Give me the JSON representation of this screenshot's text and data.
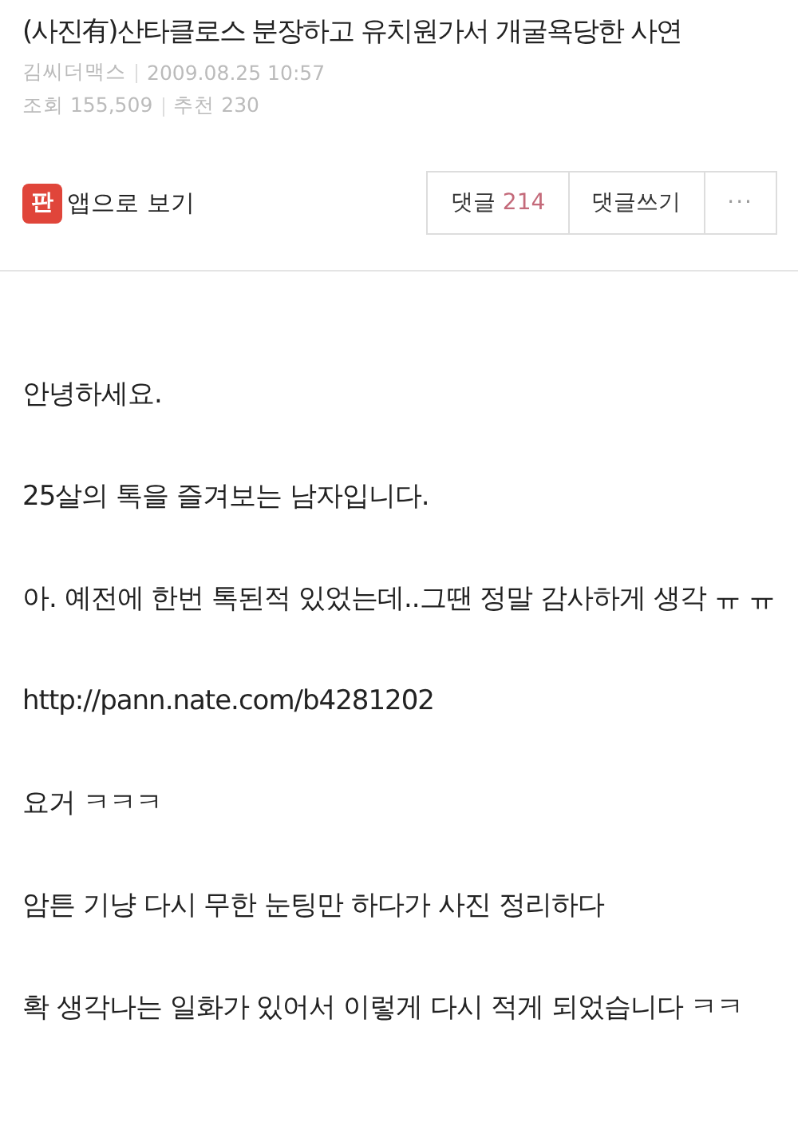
{
  "title": "(사진有)산타클로스 분장하고 유치원가서 개굴욕당한 사연",
  "author": "김씨더맥스",
  "date": "2009.08.25 10:57",
  "views_label": "조회",
  "views": "155,509",
  "recommend_label": "추천",
  "recommend": "230",
  "app_link": {
    "icon": "판",
    "label": "앱으로 보기"
  },
  "comments_button": {
    "label": "댓글",
    "count": "214"
  },
  "write_comment_button": "댓글쓰기",
  "more_button": "···",
  "paragraphs": [
    "안녕하세요.",
    "25살의 톡을 즐겨보는 남자입니다.",
    "아. 예전에 한번 톡된적 있었는데..그땐 정말 감사하게 생각 ㅠ ㅠ",
    "http://pann.nate.com/b4281202",
    "요거 ㅋㅋㅋ",
    "암튼 기냥 다시 무한 눈팅만 하다가 사진 정리하다",
    "확 생각나는 일화가 있어서 이렇게 다시 적게 되었습니다 ㅋㅋ"
  ]
}
